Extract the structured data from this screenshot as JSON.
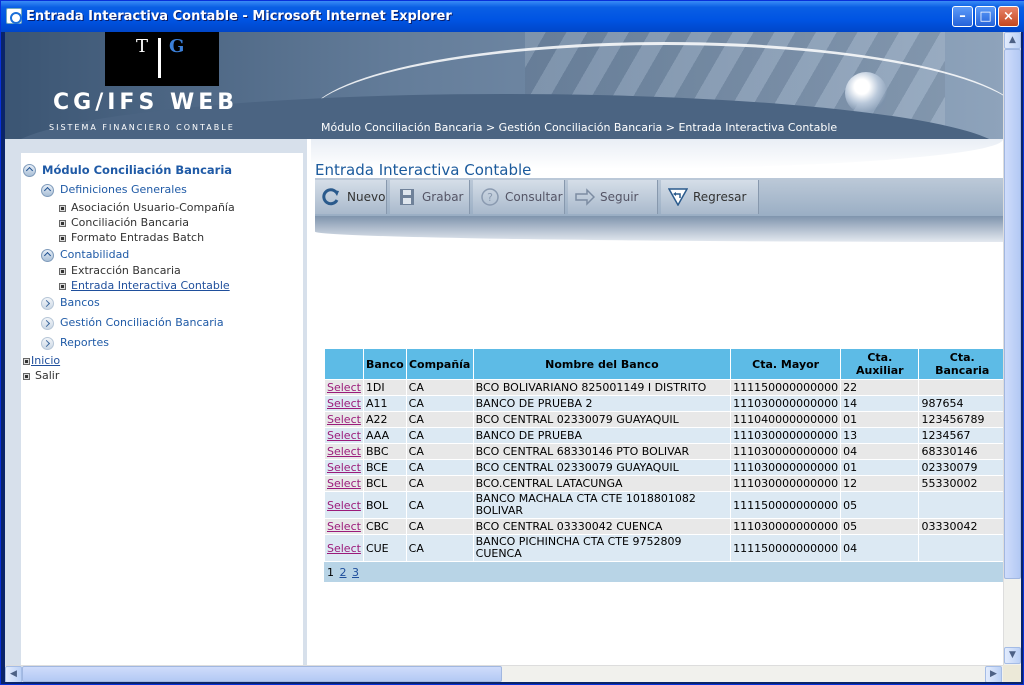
{
  "window": {
    "title": "Entrada Interactiva Contable - Microsoft Internet Explorer"
  },
  "header": {
    "logo_left": "T",
    "logo_right": "G",
    "brand": "CG/IFS  WEB",
    "subbrand": "SISTEMA FINANCIERO CONTABLE",
    "breadcrumb": "Módulo Conciliación Bancaria > Gestión Conciliación Bancaria > Entrada Interactiva Contable"
  },
  "sidebar": {
    "module": "Módulo Conciliación Bancaria",
    "definiciones": "Definiciones Generales",
    "def_items": [
      "Asociación Usuario-Compañía",
      "Conciliación Bancaria",
      "Formato Entradas Batch"
    ],
    "contabilidad": "Contabilidad",
    "cont_items": [
      "Extracción Bancaria",
      "Entrada Interactiva Contable"
    ],
    "bancos": "Bancos",
    "gestion": "Gestión Conciliación Bancaria",
    "reportes": "Reportes",
    "inicio": "Inicio",
    "salir": "Salir"
  },
  "page": {
    "title": "Entrada Interactiva Contable"
  },
  "toolbar": {
    "nuevo": "Nuevo",
    "grabar": "Grabar",
    "consultar": "Consultar",
    "seguir": "Seguir",
    "regresar": "Regresar"
  },
  "grid": {
    "headers": [
      "",
      "Banco",
      "Compañía",
      "Nombre del Banco",
      "Cta. Mayor",
      "Cta. Auxiliar",
      "Cta. Bancaria"
    ],
    "select_label": "Select",
    "rows": [
      [
        "1DI",
        "CA",
        "BCO BOLIVARIANO 825001149 I DISTRITO",
        "111150000000000",
        "22",
        ""
      ],
      [
        "A11",
        "CA",
        "BANCO DE PRUEBA 2",
        "111030000000000",
        "14",
        "987654"
      ],
      [
        "A22",
        "CA",
        "BCO CENTRAL 02330079 GUAYAQUIL",
        "111040000000000",
        "01",
        "123456789"
      ],
      [
        "AAA",
        "CA",
        "BANCO DE PRUEBA",
        "111030000000000",
        "13",
        "1234567"
      ],
      [
        "BBC",
        "CA",
        "BCO CENTRAL 68330146 PTO BOLIVAR",
        "111030000000000",
        "04",
        "68330146"
      ],
      [
        "BCE",
        "CA",
        "BCO CENTRAL 02330079 GUAYAQUIL",
        "111030000000000",
        "01",
        "02330079"
      ],
      [
        "BCL",
        "CA",
        "BCO.CENTRAL LATACUNGA",
        "111030000000000",
        "12",
        "55330002"
      ],
      [
        "BOL",
        "CA",
        "BANCO MACHALA CTA CTE 1018801082 BOLIVAR",
        "111150000000000",
        "05",
        ""
      ],
      [
        "CBC",
        "CA",
        "BCO CENTRAL 03330042 CUENCA",
        "111030000000000",
        "05",
        "03330042"
      ],
      [
        "CUE",
        "CA",
        "BANCO PICHINCHA CTA CTE 9752809 CUENCA",
        "111150000000000",
        "04",
        ""
      ]
    ],
    "pages": [
      "1",
      "2",
      "3"
    ]
  },
  "colors": {
    "accent": "#1f5aa6",
    "grid_header": "#5dbbe6",
    "titlebar": "#0054e3"
  }
}
